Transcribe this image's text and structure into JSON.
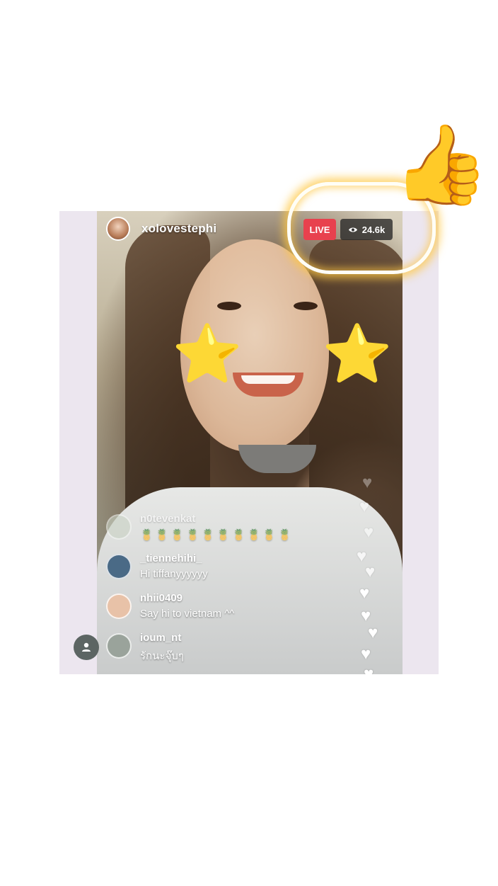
{
  "stream": {
    "username": "xolovestephi",
    "live_label": "LIVE",
    "viewer_count": "24.6k"
  },
  "overlays": {
    "thumbs_up": "👍",
    "star": "⭐"
  },
  "comments": [
    {
      "user": "n0tevenkat",
      "text": "🍍🍍🍍🍍🍍🍍🍍🍍🍍🍍",
      "avatar_color": "#c9d2c4"
    },
    {
      "user": "_tiennehihi_",
      "text": "Hi tiffanyyyyyy",
      "avatar_color": "#4a6a86"
    },
    {
      "user": "nhii0409",
      "text": "Say hi to vietnam ^^",
      "avatar_color": "#e8c2a8"
    },
    {
      "user": "ioum_nt",
      "text": "รักนะจุ๊บๆ",
      "avatar_color": "#9aa39b"
    }
  ],
  "icons": {
    "eye": "eye-icon",
    "profile": "person-icon",
    "heart": "heart-icon"
  },
  "colors": {
    "live_red": "#e8414e",
    "glow": "#ffc846"
  }
}
